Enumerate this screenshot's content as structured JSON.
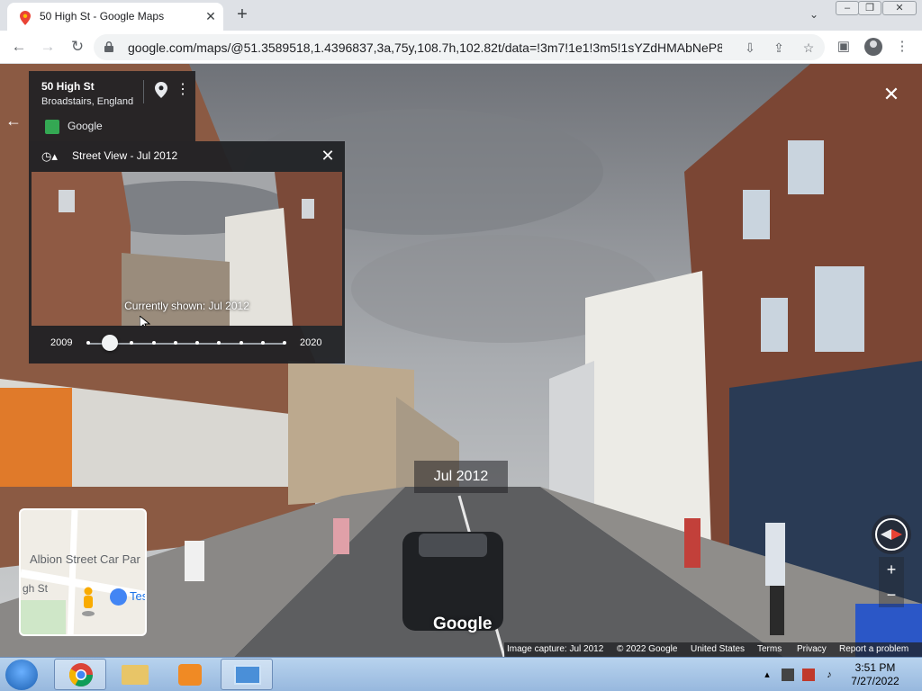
{
  "browser": {
    "tab_title": "50 High St - Google Maps",
    "url": "google.com/maps/@51.3589518,1.4396837,3a,75y,108.7h,102.82t/data=!3m7!1e1!3m5!1sYZdHMAbNeP8D..."
  },
  "place": {
    "name": "50 High St",
    "subtitle": "Broadstairs, England",
    "brand": "Google"
  },
  "time_machine": {
    "title": "Street View - Jul 2012",
    "current": "Currently shown: Jul 2012",
    "start_year": "2009",
    "end_year": "2020",
    "selected_index": 1,
    "snapshot_count": 10
  },
  "overlay": {
    "date": "Jul 2012",
    "watermark": "Google"
  },
  "minimap": {
    "label": "Albion Street Car Par",
    "road": "gh St",
    "poi": "Tes"
  },
  "footer": {
    "capture": "Image capture: Jul 2012",
    "copyright": "© 2022 Google",
    "region": "United States",
    "terms": "Terms",
    "privacy": "Privacy",
    "report": "Report a problem"
  },
  "taskbar": {
    "time": "3:51 PM",
    "date": "7/27/2022"
  },
  "icons": {
    "back": "arrow-left-icon",
    "forward": "arrow-right-icon",
    "reload": "reload-icon",
    "lock": "lock-icon",
    "bookmark": "star-icon",
    "close": "close-icon",
    "history": "history-icon",
    "pin": "map-pin-icon",
    "pegman": "pegman-icon",
    "compass": "compass-icon"
  },
  "colors": {
    "accent_blue": "#1a73e8",
    "panel_bg": "#202124"
  }
}
